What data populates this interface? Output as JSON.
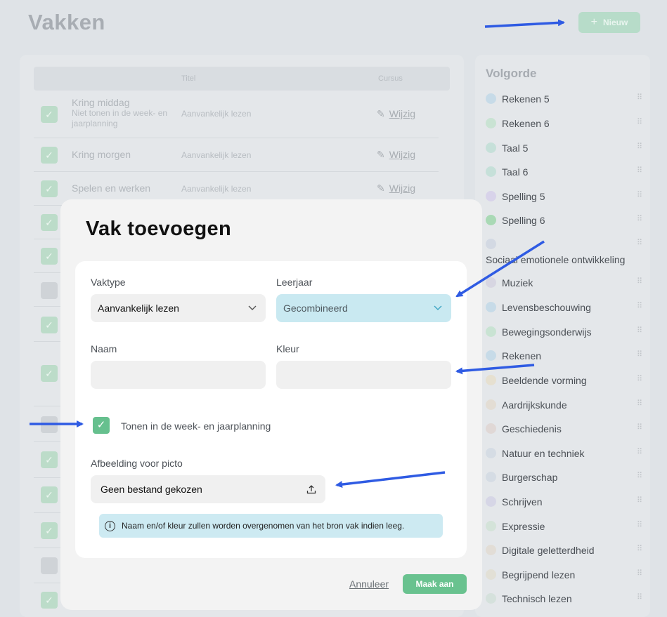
{
  "header": {
    "title": "Vakken",
    "new_button": "Nieuw"
  },
  "table": {
    "headers": [
      "Titel",
      "Cursus"
    ],
    "rows": [
      {
        "title": "Kring middag",
        "note": "Niet tonen in de week- en jaarplanning",
        "type": "Aanvankelijk lezen",
        "edit": "Wijzig"
      },
      {
        "title": "Kring morgen",
        "type": "Aanvankelijk lezen",
        "edit": "Wijzig"
      },
      {
        "title": "Spelen en werken",
        "type": "Aanvankelijk lezen",
        "edit": "Wijzig"
      }
    ]
  },
  "sidebar": {
    "title": "Volgorde",
    "items": [
      {
        "label": "Rekenen 5",
        "color": "#c7dbe8"
      },
      {
        "label": "Rekenen 6",
        "color": "#c9e3d3"
      },
      {
        "label": "Taal 5",
        "color": "#c6e0d9"
      },
      {
        "label": "Taal 6",
        "color": "#c6e0d9"
      },
      {
        "label": "Spelling 5",
        "color": "#d8d3ea"
      },
      {
        "label": "Spelling 6",
        "color": "#a9d9b5"
      },
      {
        "label": "Sociaal emotionele ontwikkeling",
        "color": "#d3d9e3"
      },
      {
        "label": "Muziek",
        "color": "#d7d6e2"
      },
      {
        "label": "Levensbeschouwing",
        "color": "#c7dbe8"
      },
      {
        "label": "Bewegingsonderwijs",
        "color": "#c9e3d3"
      },
      {
        "label": "Rekenen",
        "color": "#c7dbe8"
      },
      {
        "label": "Beeldende vorming",
        "color": "#e6e0d0"
      },
      {
        "label": "Aardrijkskunde",
        "color": "#e3ddd4"
      },
      {
        "label": "Geschiedenis",
        "color": "#e0d8d6"
      },
      {
        "label": "Natuur en techniek",
        "color": "#d5dce4"
      },
      {
        "label": "Burgerschap",
        "color": "#d5dce4"
      },
      {
        "label": "Schrijven",
        "color": "#d6d6e6"
      },
      {
        "label": "Expressie",
        "color": "#d4e3d9"
      },
      {
        "label": "Digitale geletterdheid",
        "color": "#e2ddd6"
      },
      {
        "label": "Begrijpend lezen",
        "color": "#e2e0d6"
      },
      {
        "label": "Technisch lezen",
        "color": "#d5e1dc"
      }
    ]
  },
  "modal": {
    "title": "Vak toevoegen",
    "vaktype_label": "Vaktype",
    "vaktype_value": "Aanvankelijk lezen",
    "leerjaar_label": "Leerjaar",
    "leerjaar_value": "Gecombineerd",
    "naam_label": "Naam",
    "naam_value": "",
    "kleur_label": "Kleur",
    "kleur_value": "",
    "show_checkbox_label": "Tonen in de week- en jaarplanning",
    "show_checked": true,
    "picto_label": "Afbeelding voor picto",
    "picto_value": "Geen bestand gekozen",
    "info_text": "Naam en/of kleur zullen worden overgenomen van het bron vak indien leeg.",
    "cancel_label": "Annuleer",
    "create_label": "Maak aan"
  },
  "colors": {
    "accent_green": "#69c28f",
    "highlight_blue": "#c9e9f1",
    "arrow_blue": "#2f5be3"
  }
}
